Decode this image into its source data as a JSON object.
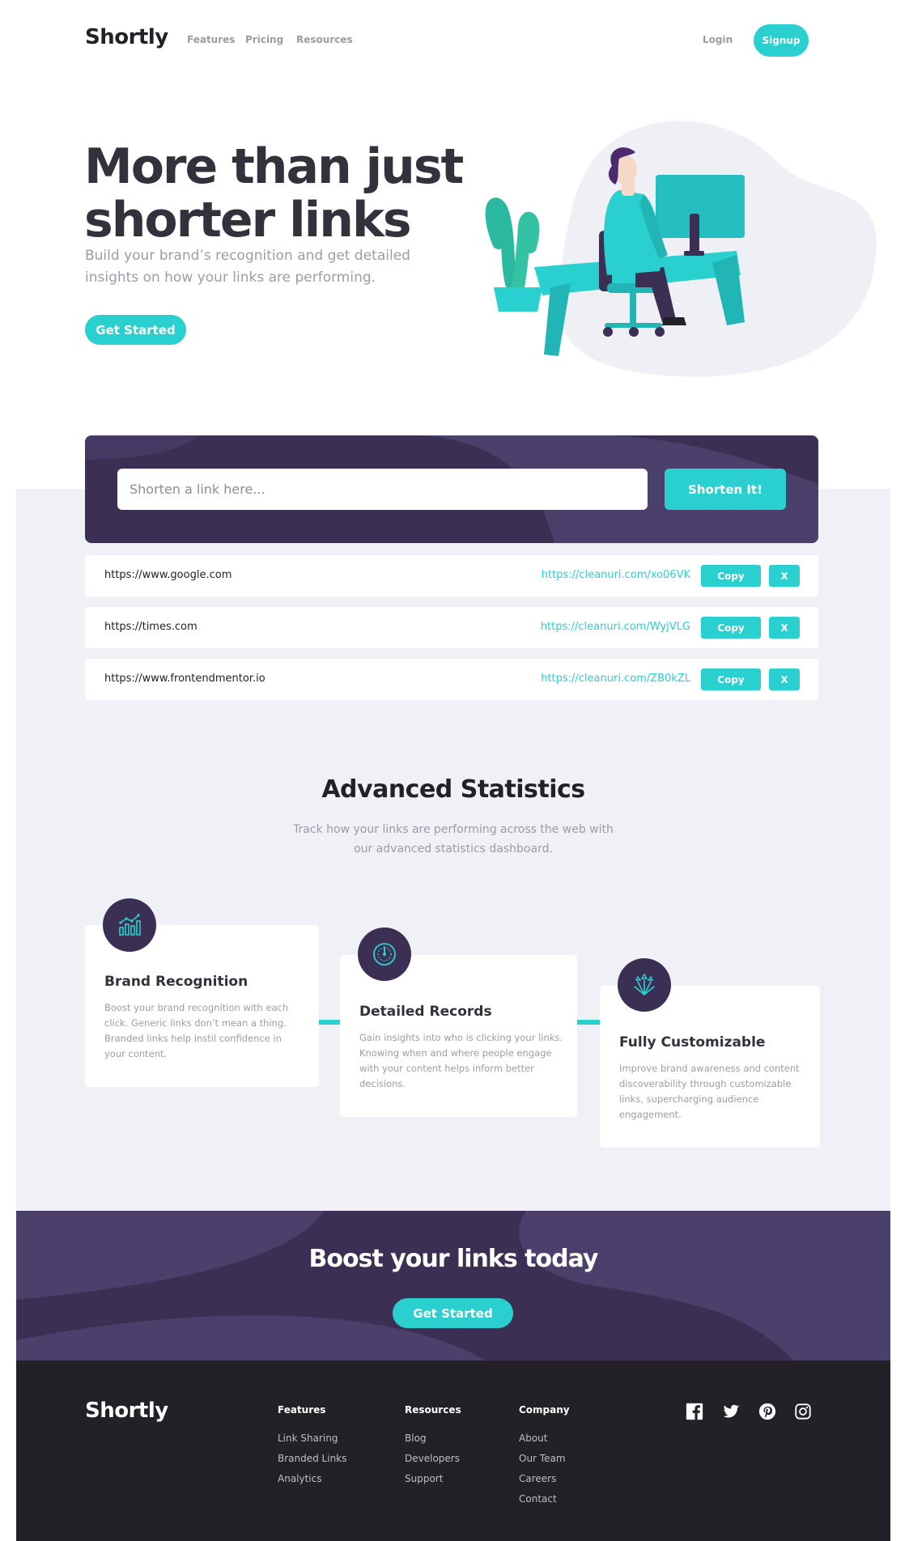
{
  "header": {
    "logo": "Shortly",
    "nav": [
      "Features",
      "Pricing",
      "Resources"
    ],
    "login": "Login",
    "signup": "Signup"
  },
  "hero": {
    "title_line1": "More than just",
    "title_line2": "shorter links",
    "subtitle_line1": "Build your brand’s recognition and get detailed",
    "subtitle_line2": "insights on how your links are performing.",
    "cta": "Get Started"
  },
  "shorten": {
    "placeholder": "Shorten a link here...",
    "button": "Shorten It!"
  },
  "results": [
    {
      "original": "https://www.google.com",
      "short": "https://cleanuri.com/xo06VK",
      "copy": "Copy",
      "remove": "X"
    },
    {
      "original": "https://times.com",
      "short": "https://cleanuri.com/WyjVLG",
      "copy": "Copy",
      "remove": "X"
    },
    {
      "original": "https://www.frontendmentor.io",
      "short": "https://cleanuri.com/ZB0kZL",
      "copy": "Copy",
      "remove": "X"
    }
  ],
  "stats": {
    "title": "Advanced Statistics",
    "subtitle_line1": "Track how your links are performing across the web with",
    "subtitle_line2": "our advanced statistics dashboard.",
    "cards": [
      {
        "icon": "brand-recognition-icon",
        "title": "Brand Recognition",
        "lines": [
          "Boost your brand recognition with each",
          "click. Generic links don’t mean a thing.",
          "Branded links help instil confidence in",
          "your content."
        ]
      },
      {
        "icon": "detailed-records-icon",
        "title": "Detailed Records",
        "lines": [
          "Gain insights into who is clicking your links.",
          "Knowing when and where people engage",
          "with your content helps inform better",
          "decisions."
        ]
      },
      {
        "icon": "fully-customizable-icon",
        "title": "Fully Customizable",
        "lines": [
          "Improve brand awareness and content",
          "discoverability through customizable",
          "links, supercharging audience",
          "engagement."
        ]
      }
    ]
  },
  "boost": {
    "title": "Boost your links today",
    "cta": "Get Started"
  },
  "footer": {
    "logo": "Shortly",
    "columns": [
      {
        "heading": "Features",
        "links": [
          "Link Sharing",
          "Branded Links",
          "Analytics"
        ]
      },
      {
        "heading": "Resources",
        "links": [
          "Blog",
          "Developers",
          "Support"
        ]
      },
      {
        "heading": "Company",
        "links": [
          "About",
          "Our Team",
          "Careers",
          "Contact"
        ]
      }
    ],
    "social": [
      "facebook-icon",
      "twitter-icon",
      "pinterest-icon",
      "instagram-icon"
    ]
  },
  "colors": {
    "primary_cyan": "#2acfcf",
    "dark_violet": "#3b3054",
    "very_dark_violet": "#232127",
    "gray": "#9e9aa7",
    "light_bg": "#eff1f7"
  }
}
